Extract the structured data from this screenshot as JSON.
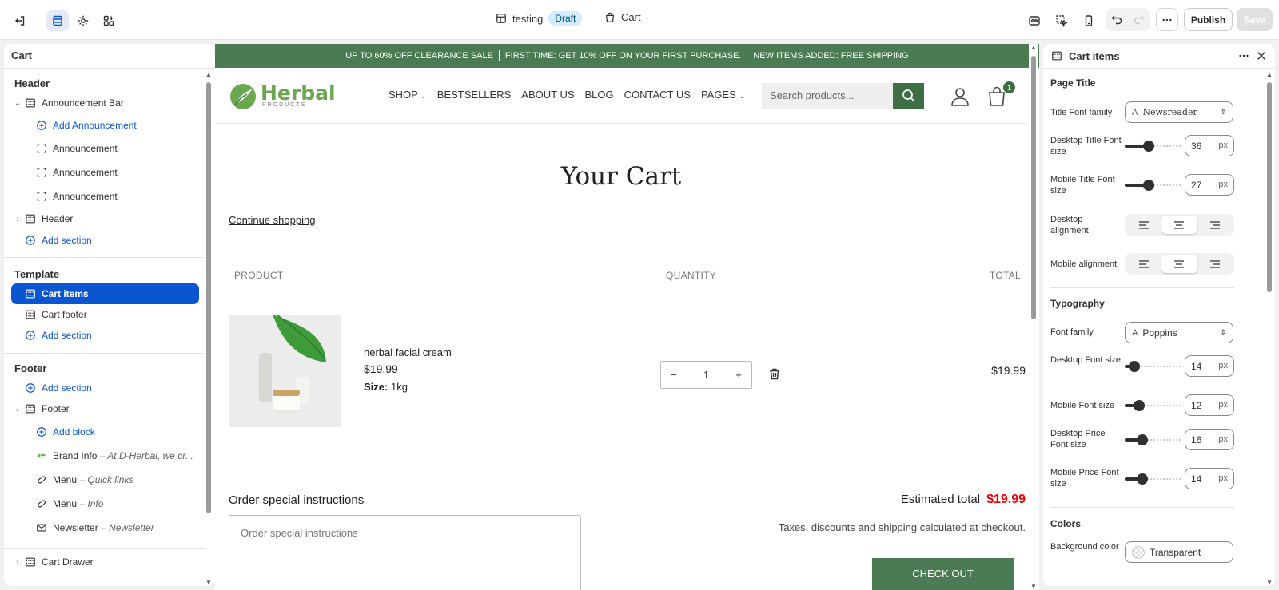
{
  "topbar": {
    "theme_name": "testing",
    "status_badge": "Draft",
    "page_name": "Cart",
    "publish_label": "Publish",
    "save_label": "Save"
  },
  "left_panel": {
    "title": "Cart",
    "groups": {
      "header": "Header",
      "template": "Template",
      "footer": "Footer"
    },
    "header_items": [
      {
        "label": "Announcement Bar"
      },
      {
        "label": "Add Announcement"
      },
      {
        "label": "Announcement"
      },
      {
        "label": "Announcement"
      },
      {
        "label": "Announcement"
      },
      {
        "label": "Header"
      },
      {
        "label": "Add section"
      }
    ],
    "template_items": [
      {
        "label": "Cart items"
      },
      {
        "label": "Cart footer"
      },
      {
        "label": "Add section"
      }
    ],
    "footer_items": [
      {
        "label": "Add section"
      },
      {
        "label": "Footer"
      },
      {
        "label": "Add block"
      },
      {
        "label": "Brand Info",
        "sub": "– At D-Herbal, we cr..."
      },
      {
        "label": "Menu",
        "sub": "– Quick links"
      },
      {
        "label": "Menu",
        "sub": "– Info"
      },
      {
        "label": "Newsletter",
        "sub": "– Newsletter"
      },
      {
        "label": "Cart Drawer"
      }
    ]
  },
  "preview": {
    "announcements": [
      "UP TO 60% OFF CLEARANCE SALE",
      "FIRST TIME: GET 10% OFF ON YOUR FIRST PURCHASE.",
      "NEW ITEMS ADDED: FREE SHIPPING"
    ],
    "logo_word": "Herbal",
    "logo_sub": "PRODUCTS",
    "nav": [
      "SHOP",
      "BESTSELLERS",
      "ABOUT US",
      "BLOG",
      "CONTACT US",
      "PAGES"
    ],
    "search_placeholder": "Search products...",
    "cart_count": "1",
    "cart_title": "Your Cart",
    "continue_shopping": "Continue shopping",
    "col_product": "PRODUCT",
    "col_quantity": "QUANTITY",
    "col_total": "TOTAL",
    "item": {
      "name": "herbal facial cream",
      "price": "$19.99",
      "size_label": "Size:",
      "size_value": "1kg",
      "qty": "1",
      "line_total": "$19.99"
    },
    "order_instructions_title": "Order special instructions",
    "order_instructions_placeholder": "Order special instructions",
    "estimated_label": "Estimated total",
    "estimated_value": "$19.99",
    "taxes_note": "Taxes, discounts and shipping calculated at checkout.",
    "checkout_label": "CHECK OUT"
  },
  "right_panel": {
    "title": "Cart items",
    "page_title_section": "Page Title",
    "title_font_family_label": "Title Font family",
    "title_font_family_value": "Newsreader",
    "desktop_title_size_label": "Desktop Title Font size",
    "desktop_title_size_value": "36",
    "mobile_title_size_label": "Mobile Title Font size",
    "mobile_title_size_value": "27",
    "desktop_alignment_label": "Desktop alignment",
    "mobile_alignment_label": "Mobile alignment",
    "typography_section": "Typography",
    "font_family_label": "Font family",
    "font_family_value": "Poppins",
    "desktop_font_size_label": "Desktop Font size",
    "desktop_font_size_value": "14",
    "mobile_font_size_label": "Mobile Font size",
    "mobile_font_size_value": "12",
    "desktop_price_size_label": "Desktop Price Font size",
    "desktop_price_size_value": "16",
    "mobile_price_size_label": "Mobile Price Font size",
    "mobile_price_size_value": "14",
    "colors_section": "Colors",
    "bg_color_label": "Background color",
    "bg_color_value": "Transparent",
    "unit": "px"
  },
  "colors": {
    "accent": "#0a56d0",
    "brand_green": "#4a7b52",
    "price_red": "#ee0000"
  }
}
